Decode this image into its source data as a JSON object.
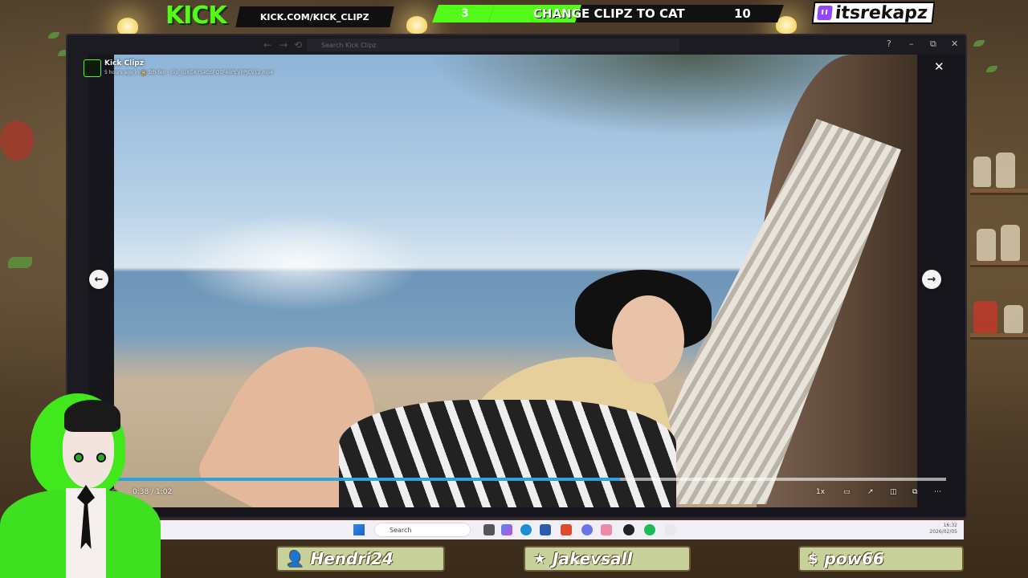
{
  "overlay": {
    "kick_logo": "KICK",
    "kick_url": "KICK.COM/KICK_CLIPZ",
    "goal": {
      "current": "3",
      "label": "CHANGE CLIPZ TO CAT",
      "target": "10",
      "progress_fraction": 0.3
    },
    "twitch_handle": "itsrekapz"
  },
  "window": {
    "search_placeholder": "Search Kick Clipz",
    "controls": {
      "minimize": "–",
      "maximize": "⧉",
      "close": "✕"
    }
  },
  "clip": {
    "channel": "Kick Clipz",
    "meta": "5 hours ago in 🔒 5th-feb  ·  clip_01KGKYS4GSFQ1F49PEVPPJCV12.mp4",
    "close": "✕",
    "prev": "←",
    "next": "→"
  },
  "player": {
    "time": "0:38 / 1:02",
    "progress_fraction": 0.613,
    "speed": "1x",
    "volume_icon": "🔈",
    "more": "⋯"
  },
  "taskbar": {
    "search": "Search",
    "clock_time": "16:32",
    "clock_date": "2026/02/05"
  },
  "viewers": [
    {
      "icon": "user-icon",
      "glyph": "👤",
      "name": "Hendri24"
    },
    {
      "icon": "star-icon",
      "glyph": "★",
      "name": "Jakevsall"
    },
    {
      "icon": "dollar-icon",
      "glyph": "$",
      "name": "pow66"
    }
  ],
  "colors": {
    "kick_green": "#53fc18",
    "progress_blue": "#2ba3e0",
    "twitch_purple": "#9146ff"
  }
}
